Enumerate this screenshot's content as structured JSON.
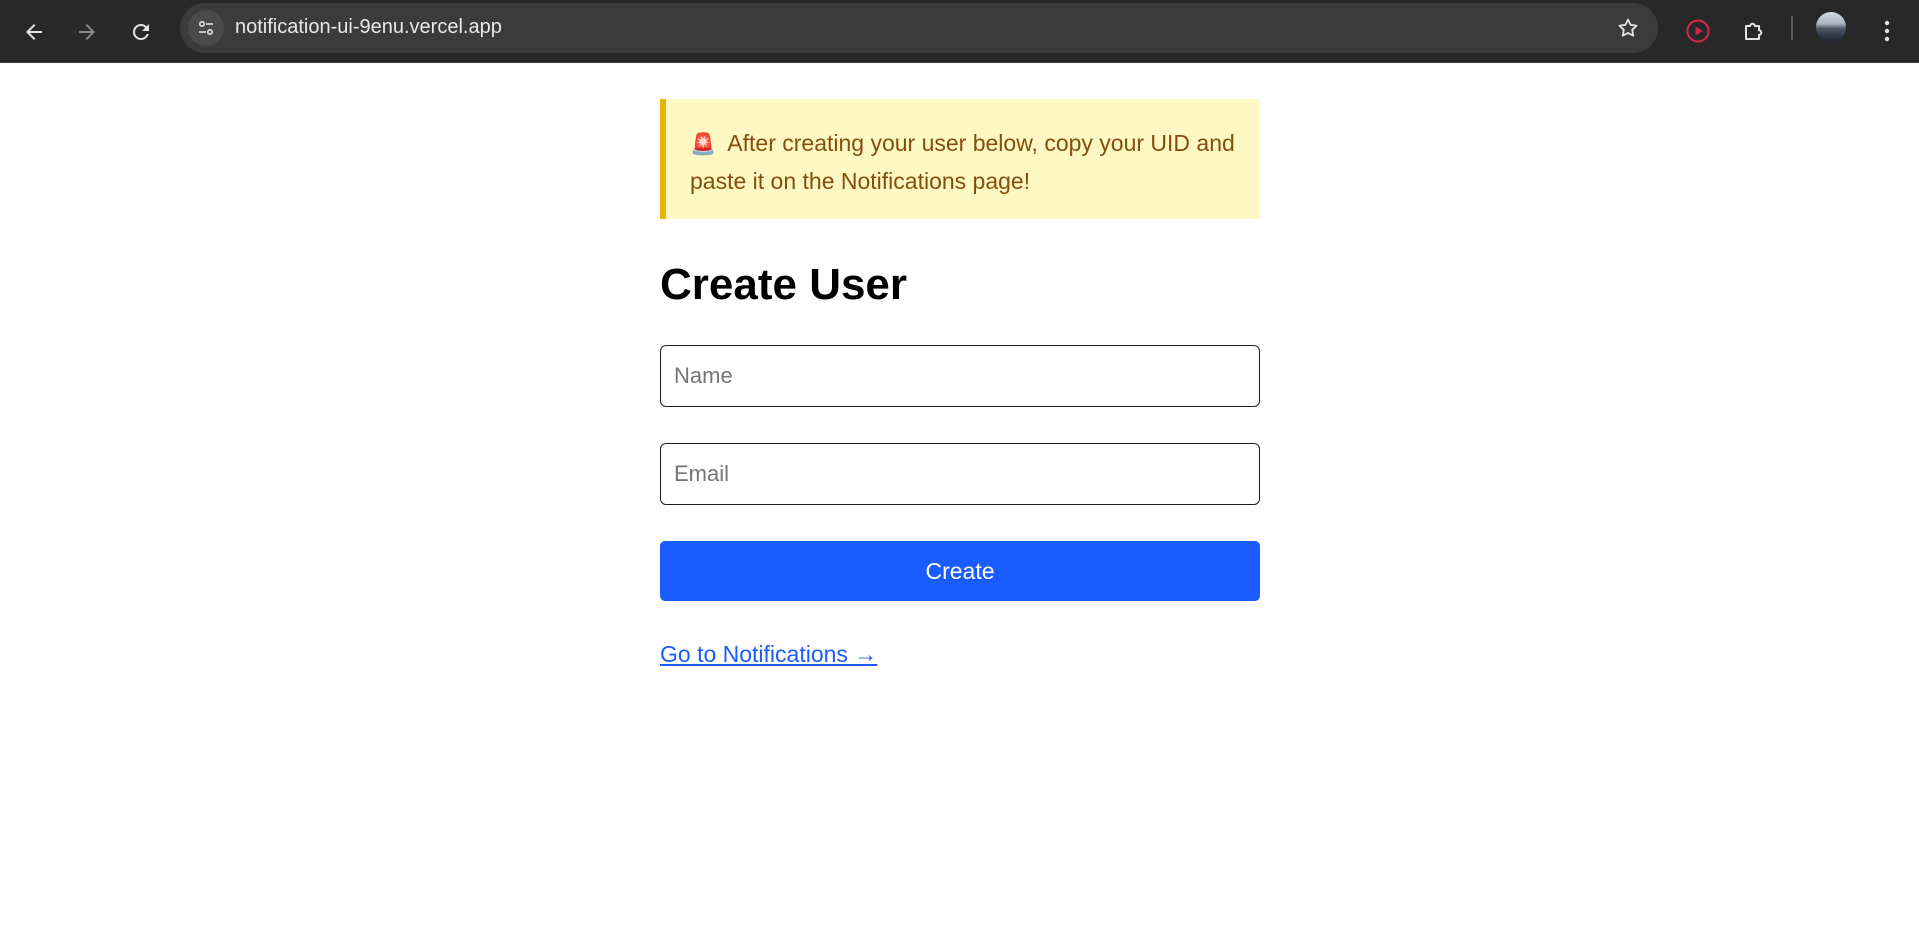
{
  "browser": {
    "url": "notification-ui-9enu.vercel.app",
    "icons": {
      "back": "back-arrow-icon",
      "forward": "forward-arrow-icon",
      "reload": "reload-icon",
      "site_info": "tune-icon",
      "bookmark": "star-icon",
      "extension_record": "record-icon",
      "extensions": "puzzle-icon",
      "menu": "kebab-menu-icon"
    }
  },
  "banner": {
    "icon": "🚨",
    "text": "After creating your user below, copy your UID and paste it on the Notifications page!"
  },
  "page": {
    "title": "Create User"
  },
  "form": {
    "name_placeholder": "Name",
    "email_placeholder": "Email",
    "name_value": "",
    "email_value": "",
    "create_label": "Create"
  },
  "link": {
    "label": "Go to Notifications →"
  },
  "colors": {
    "accent": "#1a5cff",
    "banner_bg": "#fef9c3",
    "banner_border": "#eab308",
    "banner_text": "#854d0e",
    "chrome_bg": "#282828"
  }
}
